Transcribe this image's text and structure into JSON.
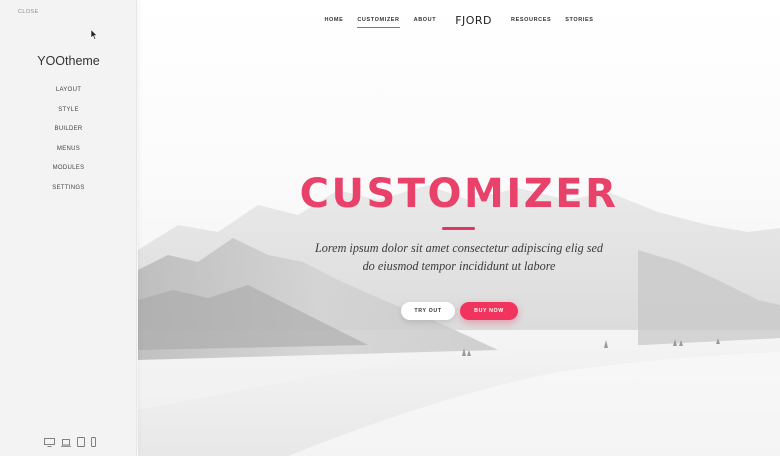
{
  "sidebar": {
    "close_label": "CLOSE",
    "brand": "YOOtheme",
    "menu": [
      "LAYOUT",
      "STYLE",
      "BUILDER",
      "MENUS",
      "MODULES",
      "SETTINGS"
    ],
    "device_icons": [
      "desktop-icon",
      "laptop-icon",
      "tablet-icon",
      "phone-icon"
    ]
  },
  "preview": {
    "nav": {
      "left": [
        "HOME",
        "CUSTOMIZER",
        "ABOUT"
      ],
      "logo": "FJORD",
      "right": [
        "RESOURCES",
        "STORIES"
      ],
      "active": "CUSTOMIZER"
    },
    "hero": {
      "title": "CUSTOMIZER",
      "subtitle_line1": "Lorem ipsum dolor sit amet consectetur adipiscing elig sed",
      "subtitle_line2": "do eiusmod tempor incididunt ut labore",
      "try_label": "TRY OUT",
      "buy_label": "BUY NOW"
    }
  },
  "colors": {
    "accent": "#e8416a",
    "sidebar_bg": "#f3f3f3"
  }
}
